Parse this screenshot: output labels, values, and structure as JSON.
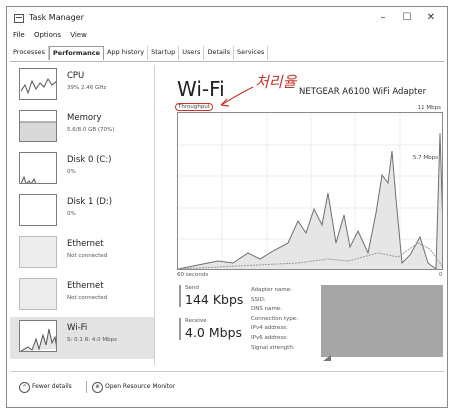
{
  "window": {
    "title": "Task Manager",
    "minimize": "–",
    "maximize": "☐",
    "close": "✕"
  },
  "menu": [
    "File",
    "Options",
    "View"
  ],
  "tabs": [
    {
      "label": "Processes"
    },
    {
      "label": "Performance",
      "active": true
    },
    {
      "label": "App history"
    },
    {
      "label": "Startup"
    },
    {
      "label": "Users"
    },
    {
      "label": "Details"
    },
    {
      "label": "Services"
    }
  ],
  "sidebar": [
    {
      "name": "CPU",
      "sub": "39%  2.46 GHz"
    },
    {
      "name": "Memory",
      "sub": "5.6/8.0 GB (70%)"
    },
    {
      "name": "Disk 0 (C:)",
      "sub": "0%"
    },
    {
      "name": "Disk 1 (D:)",
      "sub": "0%"
    },
    {
      "name": "Ethernet",
      "sub": "Not connected"
    },
    {
      "name": "Ethernet",
      "sub": "Not connected"
    },
    {
      "name": "Wi-Fi",
      "sub": "S: 0.1  R: 4.0 Mbps",
      "active": true
    }
  ],
  "main": {
    "title": "Wi-Fi",
    "adapter": "NETGEAR A6100 WiFi Adapter",
    "annotation": "처리율",
    "throughput_label": "Throughput",
    "max_label": "11 Mbps",
    "mid_label": "5.7 Mbps",
    "axis_left": "60 seconds",
    "axis_right": "0",
    "send_label": "Send",
    "send_value": "144 Kbps",
    "receive_label": "Receive",
    "receive_value": "4.0 Mbps",
    "props": [
      "Adapter name:",
      "SSID:",
      "DNS name:",
      "Connection type:",
      "IPv4 address:",
      "IPv6 address:",
      "Signal strength:"
    ]
  },
  "footer": {
    "fewer_details": "Fewer details",
    "open_monitor": "Open Resource Monitor"
  },
  "colors": {
    "accent_red": "#c8362a",
    "graph_line": "#6f6f6f",
    "graph_fill": "#e6e6e6"
  }
}
